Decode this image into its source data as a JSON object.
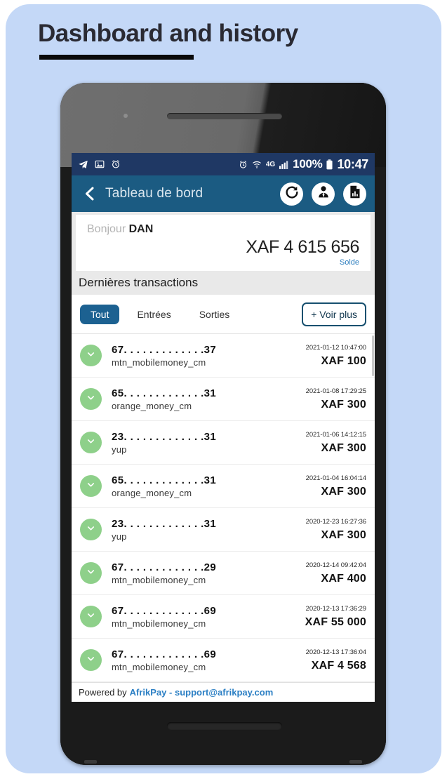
{
  "page": {
    "title": "Dashboard and history",
    "background_color": "#c4d8f7",
    "accent_color": "#1b5b82"
  },
  "status_bar": {
    "left_icons": [
      "telegram-send-icon",
      "image-icon",
      "alarm-clock-icon"
    ],
    "alarm_icon": "alarm-clock-icon",
    "wifi_icon": "wifi-icon",
    "network_type": "4G",
    "signal_icon": "signal-bars-icon",
    "battery_percent": "100%",
    "battery_icon": "battery-full-icon",
    "time": "10:47"
  },
  "app_bar": {
    "back_label": "back",
    "title": "Tableau de bord",
    "actions": [
      {
        "name": "refresh-button",
        "icon": "refresh-icon"
      },
      {
        "name": "profile-button",
        "icon": "user-tie-icon"
      },
      {
        "name": "reports-button",
        "icon": "document-chart-icon"
      }
    ]
  },
  "balance_card": {
    "greeting": "Bonjour",
    "user_name": "DAN",
    "amount": "XAF 4 615 656",
    "amount_label": "Solde"
  },
  "section": {
    "header": "Dernières transactions"
  },
  "filters": {
    "tabs": [
      {
        "label": "Tout",
        "active": true
      },
      {
        "label": "Entrées",
        "active": false
      },
      {
        "label": "Sorties",
        "active": false
      }
    ],
    "more_button": "+ Voir plus"
  },
  "transactions": [
    {
      "number": "67. . . . . . . . . . . . .37",
      "provider": "mtn_mobilemoney_cm",
      "date": "2021-01-12 10:47:00",
      "amount": "XAF 100",
      "direction": "in"
    },
    {
      "number": "65. . . . . . . . . . . . .31",
      "provider": "orange_money_cm",
      "date": "2021-01-08 17:29:25",
      "amount": "XAF 300",
      "direction": "in"
    },
    {
      "number": "23. . . . . . . . . . . . .31",
      "provider": "yup",
      "date": "2021-01-06 14:12:15",
      "amount": "XAF 300",
      "direction": "in"
    },
    {
      "number": "65. . . . . . . . . . . . .31",
      "provider": "orange_money_cm",
      "date": "2021-01-04 16:04:14",
      "amount": "XAF 300",
      "direction": "in"
    },
    {
      "number": "23. . . . . . . . . . . . .31",
      "provider": "yup",
      "date": "2020-12-23 16:27:36",
      "amount": "XAF 300",
      "direction": "in"
    },
    {
      "number": "67. . . . . . . . . . . . .29",
      "provider": "mtn_mobilemoney_cm",
      "date": "2020-12-14 09:42:04",
      "amount": "XAF 400",
      "direction": "in"
    },
    {
      "number": "67. . . . . . . . . . . . .69",
      "provider": "mtn_mobilemoney_cm",
      "date": "2020-12-13 17:36:29",
      "amount": "XAF 55 000",
      "direction": "in"
    },
    {
      "number": "67. . . . . . . . . . . . .69",
      "provider": "mtn_mobilemoney_cm",
      "date": "2020-12-13 17:36:04",
      "amount": "XAF 4 568",
      "direction": "in"
    }
  ],
  "footer": {
    "prefix": "Powered by",
    "link": "AfrikPay - support@afrikpay.com"
  }
}
